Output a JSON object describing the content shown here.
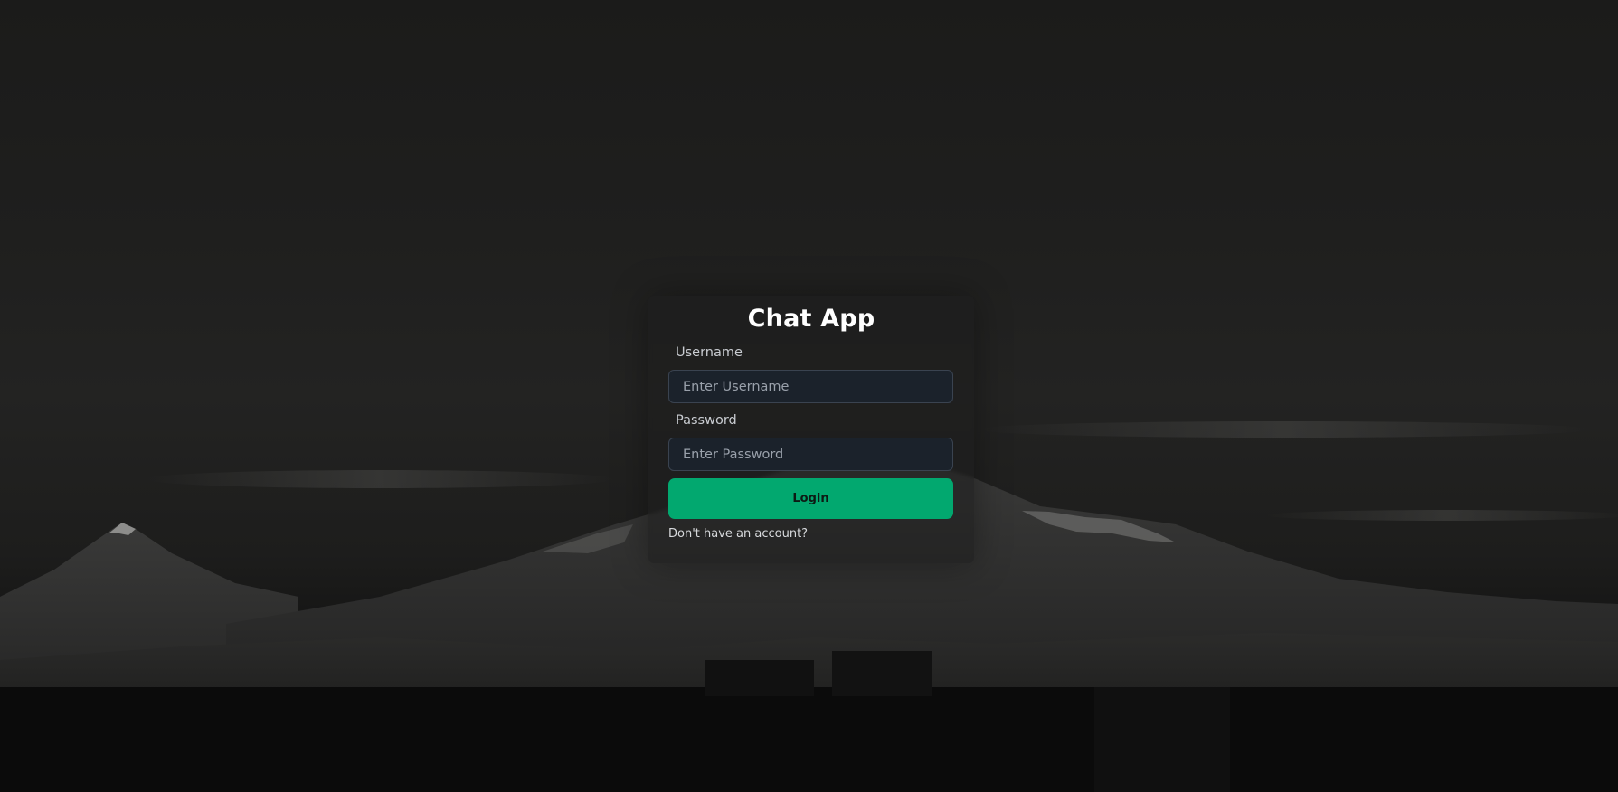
{
  "app": {
    "title": "Chat App"
  },
  "login_form": {
    "username_label": "Username",
    "username_placeholder": "Enter Username",
    "username_value": "",
    "password_label": "Password",
    "password_placeholder": "Enter Password",
    "password_value": "",
    "login_button_label": "Login",
    "signup_link_text": "Don't have an account?"
  },
  "colors": {
    "accent": "#02a86f",
    "input_background": "#1b222b",
    "page_background": "#1b1b1a"
  },
  "background": {
    "icon": "mountain-landscape"
  }
}
